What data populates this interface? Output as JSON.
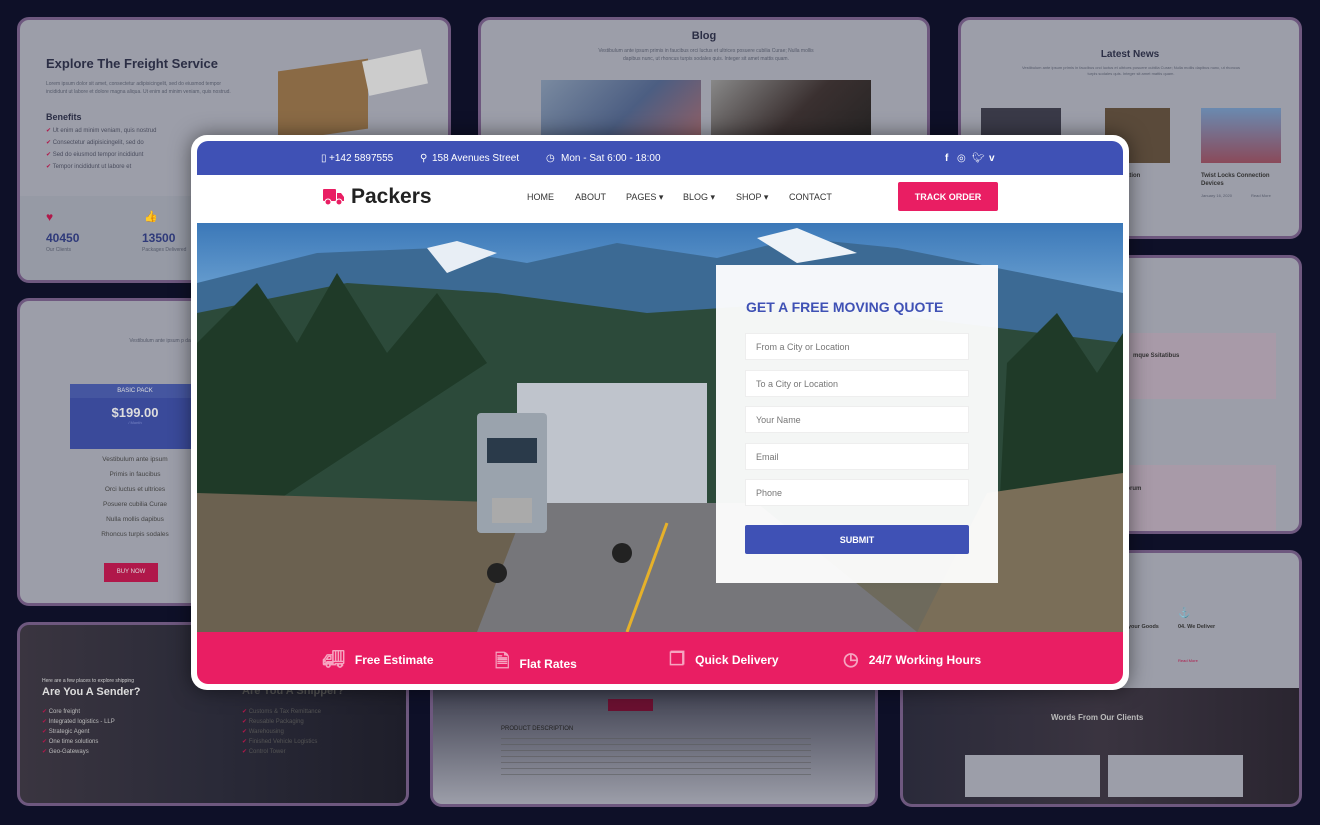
{
  "colors": {
    "background": "#0e1028",
    "primary": "#3f51b5",
    "accent": "#e91e63"
  },
  "bg_freight": {
    "title": "Explore The Freight Service",
    "text": "Lorem ipsum dolor sit amet, consectetur adipisicingelit, sed do eiusmod tempor incididunt ut labore et dolore magna aliqua. Ut enim ad minim veniam, quis nostrud.",
    "benefits_title": "Benefits",
    "benefits": [
      "Ut enim ad minim veniam, quis nostrud",
      "Consectetur adipisicingelit, sed do",
      "Sed do eiusmod tempor incididunt",
      "Tempor incididunt ut labore et"
    ],
    "stats": [
      {
        "value": "40450",
        "label": "Our Clients",
        "icon": "heart-icon"
      },
      {
        "value": "13500",
        "label": "Packages Delivered",
        "icon": "thumbs-up-icon"
      }
    ]
  },
  "bg_blog": {
    "title": "Blog",
    "text": "Vestibulum ante ipsum primis in faucibus orci luctus et ultrices posuere cubilia Curae; Nulla mollis dapibus nunc, ut rhoncus turpis sodales quis. Integer sit amet mattis quam."
  },
  "bg_news": {
    "title": "Latest News",
    "text": "Vestibulum ante ipsum primis in faucibus orci luctus et ultrices posuere cubilia Curae; Nulla mollis dapibus nunc, ut rhoncus turpis sodales quis. Integer sit amet mattis quam.",
    "items": [
      {
        "title": "sportation"
      },
      {
        "title": "Twist Locks Connection Devices",
        "date": "January 16, 2020",
        "more": "Read More"
      }
    ]
  },
  "bg_pricing": {
    "text": "Vestibulum ante ipsum p dapibus nunc",
    "plan": "BASIC PACK",
    "price": "$199.00",
    "period": "/ Month",
    "features": [
      "Vestibulum ante ipsum",
      "Primis in faucibus",
      "Orci luctus et ultrices",
      "Posuere cubilia Curae",
      "Nulla mollis dapibus",
      "Rhoncus turpis sodales"
    ],
    "buy": "BUY NOW"
  },
  "bg_sender": {
    "kicker": "Here are a few places to explore shipping",
    "title": "Are You A Sender?",
    "items": [
      "Core freight",
      "Integrated logistics - LLP",
      "Strategic Agent",
      "One time solutions",
      "Geo-Gateways"
    ],
    "title2": "Are You A Shipper?",
    "items2": [
      "Customs & Tax Remittance",
      "Reusable Packaging",
      "Warehousing",
      "Finished Vehicle Logistics",
      "Control Tower"
    ]
  },
  "bg_services": {
    "items": [
      {
        "title": "mque Ssitatibus"
      },
      {
        "title": "ndae Quis Laborum"
      }
    ]
  },
  "bg_process": {
    "items": [
      {
        "title": "your Goods"
      },
      {
        "title": "04. We Deliver",
        "more": "Read More"
      }
    ],
    "testimonials_title": "Words From Our Clients"
  },
  "bg_product": {
    "heading": "PRODUCT DESCRIPTION"
  },
  "topbar": {
    "phone": "+142 5897555",
    "address": "158 Avenues Street",
    "hours": "Mon - Sat 6:00 - 18:00",
    "social": [
      "facebook-icon",
      "instagram-icon",
      "twitter-icon",
      "vimeo-icon"
    ]
  },
  "nav": {
    "logo": "Packers",
    "items": [
      "HOME",
      "ABOUT",
      "PAGES ▾",
      "BLOG ▾",
      "SHOP ▾",
      "CONTACT"
    ],
    "cta": "TRACK ORDER"
  },
  "quote": {
    "title": "GET A FREE MOVING QUOTE",
    "fields": [
      "From a City or Location",
      "To a City or Location",
      "Your Name",
      "Email",
      "Phone"
    ],
    "submit": "SUBMIT"
  },
  "features": [
    {
      "icon": "truck-icon",
      "label": "Free Estimate"
    },
    {
      "icon": "document-icon",
      "label": "Flat Rates"
    },
    {
      "icon": "copy-icon",
      "label": "Quick Delivery"
    },
    {
      "icon": "clock-icon",
      "label": "24/7 Working Hours"
    }
  ]
}
